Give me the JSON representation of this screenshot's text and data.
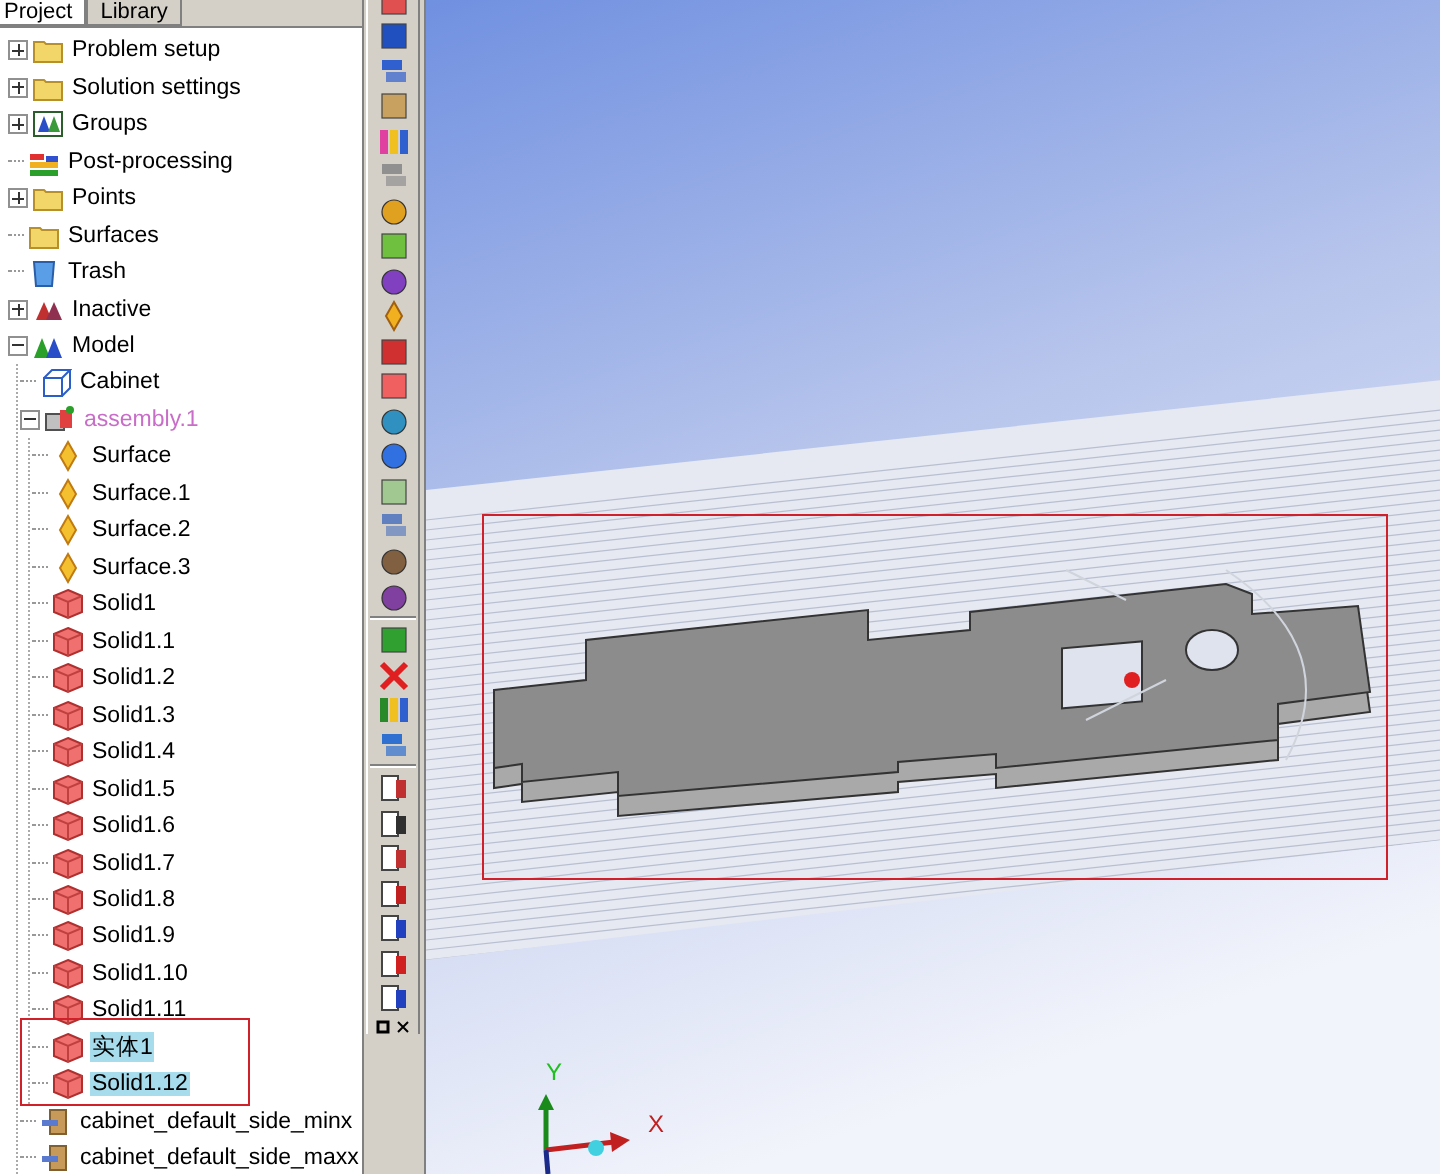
{
  "tabs": [
    {
      "label": "Project",
      "selected": true
    },
    {
      "label": "Library",
      "selected": false
    }
  ],
  "tree": [
    {
      "label": "Problem setup",
      "kind": "folder",
      "expanded": false,
      "selected": false
    },
    {
      "label": "Solution settings",
      "kind": "folder",
      "expanded": false,
      "selected": false
    },
    {
      "label": "Groups",
      "kind": "groups",
      "expanded": false,
      "selected": false
    },
    {
      "label": "Post-processing",
      "kind": "post",
      "selected": false
    },
    {
      "label": "Points",
      "kind": "folder",
      "expanded": false,
      "selected": false
    },
    {
      "label": "Surfaces",
      "kind": "folder",
      "selected": false
    },
    {
      "label": "Trash",
      "kind": "trash",
      "selected": false
    },
    {
      "label": "Inactive",
      "kind": "inactive",
      "expanded": false,
      "selected": false
    },
    {
      "label": "Model",
      "kind": "model",
      "expanded": true,
      "selected": false,
      "children": [
        {
          "label": "Cabinet",
          "kind": "cabinet",
          "selected": false
        },
        {
          "label": "assembly.1",
          "kind": "assembly",
          "expanded": true,
          "selected": false,
          "children": [
            {
              "label": "Surface",
              "kind": "surface",
              "selected": false
            },
            {
              "label": "Surface.1",
              "kind": "surface",
              "selected": false
            },
            {
              "label": "Surface.2",
              "kind": "surface",
              "selected": false
            },
            {
              "label": "Surface.3",
              "kind": "surface",
              "selected": false
            },
            {
              "label": "Solid1",
              "kind": "solid",
              "selected": false
            },
            {
              "label": "Solid1.1",
              "kind": "solid",
              "selected": false
            },
            {
              "label": "Solid1.2",
              "kind": "solid",
              "selected": false
            },
            {
              "label": "Solid1.3",
              "kind": "solid",
              "selected": false
            },
            {
              "label": "Solid1.4",
              "kind": "solid",
              "selected": false
            },
            {
              "label": "Solid1.5",
              "kind": "solid",
              "selected": false
            },
            {
              "label": "Solid1.6",
              "kind": "solid",
              "selected": false
            },
            {
              "label": "Solid1.7",
              "kind": "solid",
              "selected": false
            },
            {
              "label": "Solid1.8",
              "kind": "solid",
              "selected": false
            },
            {
              "label": "Solid1.9",
              "kind": "solid",
              "selected": false
            },
            {
              "label": "Solid1.10",
              "kind": "solid",
              "selected": false
            },
            {
              "label": "Solid1.11",
              "kind": "solid",
              "selected": false
            },
            {
              "label": "实体1",
              "kind": "solid",
              "selected": true
            },
            {
              "label": "Solid1.12",
              "kind": "solid",
              "selected": true
            }
          ]
        },
        {
          "label": "cabinet_default_side_minx",
          "kind": "side",
          "selected": false
        },
        {
          "label": "cabinet_default_side_maxx",
          "kind": "side",
          "selected": false
        }
      ]
    }
  ],
  "axis_triad": {
    "y_label": "Y",
    "x_label": "X"
  }
}
